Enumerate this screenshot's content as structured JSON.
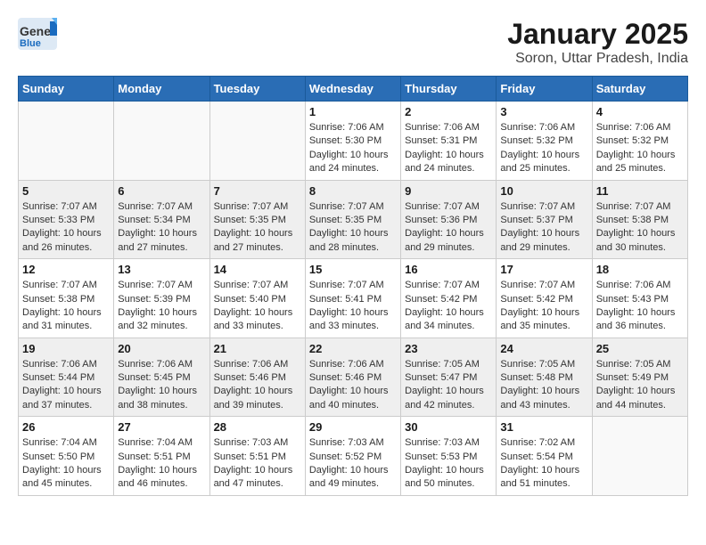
{
  "header": {
    "logo_general": "General",
    "logo_blue": "Blue",
    "month": "January 2025",
    "location": "Soron, Uttar Pradesh, India"
  },
  "weekdays": [
    "Sunday",
    "Monday",
    "Tuesday",
    "Wednesday",
    "Thursday",
    "Friday",
    "Saturday"
  ],
  "weeks": [
    [
      {
        "day": "",
        "info": ""
      },
      {
        "day": "",
        "info": ""
      },
      {
        "day": "",
        "info": ""
      },
      {
        "day": "1",
        "info": "Sunrise: 7:06 AM\nSunset: 5:30 PM\nDaylight: 10 hours\nand 24 minutes."
      },
      {
        "day": "2",
        "info": "Sunrise: 7:06 AM\nSunset: 5:31 PM\nDaylight: 10 hours\nand 24 minutes."
      },
      {
        "day": "3",
        "info": "Sunrise: 7:06 AM\nSunset: 5:32 PM\nDaylight: 10 hours\nand 25 minutes."
      },
      {
        "day": "4",
        "info": "Sunrise: 7:06 AM\nSunset: 5:32 PM\nDaylight: 10 hours\nand 25 minutes."
      }
    ],
    [
      {
        "day": "5",
        "info": "Sunrise: 7:07 AM\nSunset: 5:33 PM\nDaylight: 10 hours\nand 26 minutes."
      },
      {
        "day": "6",
        "info": "Sunrise: 7:07 AM\nSunset: 5:34 PM\nDaylight: 10 hours\nand 27 minutes."
      },
      {
        "day": "7",
        "info": "Sunrise: 7:07 AM\nSunset: 5:35 PM\nDaylight: 10 hours\nand 27 minutes."
      },
      {
        "day": "8",
        "info": "Sunrise: 7:07 AM\nSunset: 5:35 PM\nDaylight: 10 hours\nand 28 minutes."
      },
      {
        "day": "9",
        "info": "Sunrise: 7:07 AM\nSunset: 5:36 PM\nDaylight: 10 hours\nand 29 minutes."
      },
      {
        "day": "10",
        "info": "Sunrise: 7:07 AM\nSunset: 5:37 PM\nDaylight: 10 hours\nand 29 minutes."
      },
      {
        "day": "11",
        "info": "Sunrise: 7:07 AM\nSunset: 5:38 PM\nDaylight: 10 hours\nand 30 minutes."
      }
    ],
    [
      {
        "day": "12",
        "info": "Sunrise: 7:07 AM\nSunset: 5:38 PM\nDaylight: 10 hours\nand 31 minutes."
      },
      {
        "day": "13",
        "info": "Sunrise: 7:07 AM\nSunset: 5:39 PM\nDaylight: 10 hours\nand 32 minutes."
      },
      {
        "day": "14",
        "info": "Sunrise: 7:07 AM\nSunset: 5:40 PM\nDaylight: 10 hours\nand 33 minutes."
      },
      {
        "day": "15",
        "info": "Sunrise: 7:07 AM\nSunset: 5:41 PM\nDaylight: 10 hours\nand 33 minutes."
      },
      {
        "day": "16",
        "info": "Sunrise: 7:07 AM\nSunset: 5:42 PM\nDaylight: 10 hours\nand 34 minutes."
      },
      {
        "day": "17",
        "info": "Sunrise: 7:07 AM\nSunset: 5:42 PM\nDaylight: 10 hours\nand 35 minutes."
      },
      {
        "day": "18",
        "info": "Sunrise: 7:06 AM\nSunset: 5:43 PM\nDaylight: 10 hours\nand 36 minutes."
      }
    ],
    [
      {
        "day": "19",
        "info": "Sunrise: 7:06 AM\nSunset: 5:44 PM\nDaylight: 10 hours\nand 37 minutes."
      },
      {
        "day": "20",
        "info": "Sunrise: 7:06 AM\nSunset: 5:45 PM\nDaylight: 10 hours\nand 38 minutes."
      },
      {
        "day": "21",
        "info": "Sunrise: 7:06 AM\nSunset: 5:46 PM\nDaylight: 10 hours\nand 39 minutes."
      },
      {
        "day": "22",
        "info": "Sunrise: 7:06 AM\nSunset: 5:46 PM\nDaylight: 10 hours\nand 40 minutes."
      },
      {
        "day": "23",
        "info": "Sunrise: 7:05 AM\nSunset: 5:47 PM\nDaylight: 10 hours\nand 42 minutes."
      },
      {
        "day": "24",
        "info": "Sunrise: 7:05 AM\nSunset: 5:48 PM\nDaylight: 10 hours\nand 43 minutes."
      },
      {
        "day": "25",
        "info": "Sunrise: 7:05 AM\nSunset: 5:49 PM\nDaylight: 10 hours\nand 44 minutes."
      }
    ],
    [
      {
        "day": "26",
        "info": "Sunrise: 7:04 AM\nSunset: 5:50 PM\nDaylight: 10 hours\nand 45 minutes."
      },
      {
        "day": "27",
        "info": "Sunrise: 7:04 AM\nSunset: 5:51 PM\nDaylight: 10 hours\nand 46 minutes."
      },
      {
        "day": "28",
        "info": "Sunrise: 7:03 AM\nSunset: 5:51 PM\nDaylight: 10 hours\nand 47 minutes."
      },
      {
        "day": "29",
        "info": "Sunrise: 7:03 AM\nSunset: 5:52 PM\nDaylight: 10 hours\nand 49 minutes."
      },
      {
        "day": "30",
        "info": "Sunrise: 7:03 AM\nSunset: 5:53 PM\nDaylight: 10 hours\nand 50 minutes."
      },
      {
        "day": "31",
        "info": "Sunrise: 7:02 AM\nSunset: 5:54 PM\nDaylight: 10 hours\nand 51 minutes."
      },
      {
        "day": "",
        "info": ""
      }
    ]
  ]
}
